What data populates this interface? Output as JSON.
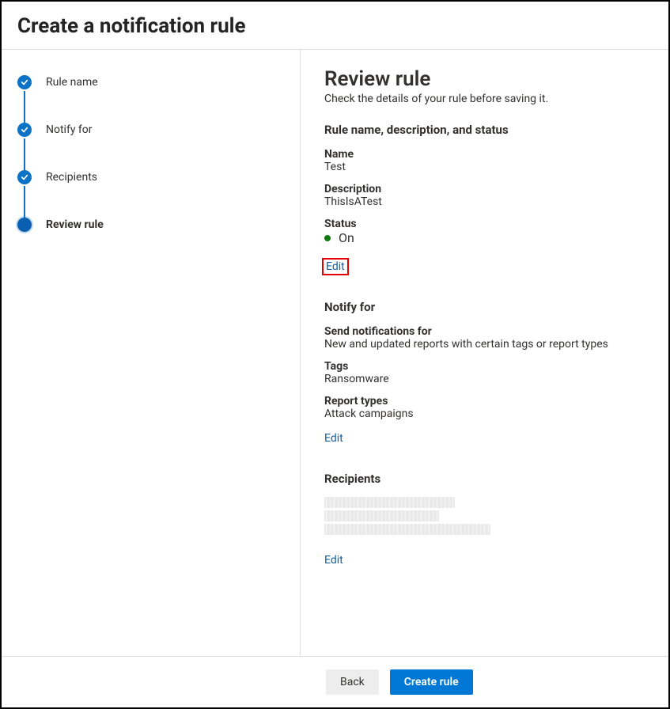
{
  "page": {
    "title": "Create a notification rule"
  },
  "steps": [
    {
      "label": "Rule name",
      "state": "done"
    },
    {
      "label": "Notify for",
      "state": "done"
    },
    {
      "label": "Recipients",
      "state": "done"
    },
    {
      "label": "Review rule",
      "state": "current"
    }
  ],
  "review": {
    "heading": "Review rule",
    "subheading": "Check the details of your rule before saving it.",
    "section1": {
      "title": "Rule name, description, and status",
      "name_label": "Name",
      "name_value": "Test",
      "desc_label": "Description",
      "desc_value": "ThisIsATest",
      "status_label": "Status",
      "status_value": "On",
      "status_color": "#107c10",
      "edit": "Edit"
    },
    "section2": {
      "title": "Notify for",
      "send_label": "Send notifications for",
      "send_value": "New and updated reports with certain tags or report types",
      "tags_label": "Tags",
      "tags_value": "Ransomware",
      "types_label": "Report types",
      "types_value": "Attack campaigns",
      "edit": "Edit"
    },
    "section3": {
      "title": "Recipients",
      "edit": "Edit"
    }
  },
  "footer": {
    "back": "Back",
    "create": "Create rule"
  },
  "accent_color": "#0078d4",
  "link_color": "#115ea3"
}
